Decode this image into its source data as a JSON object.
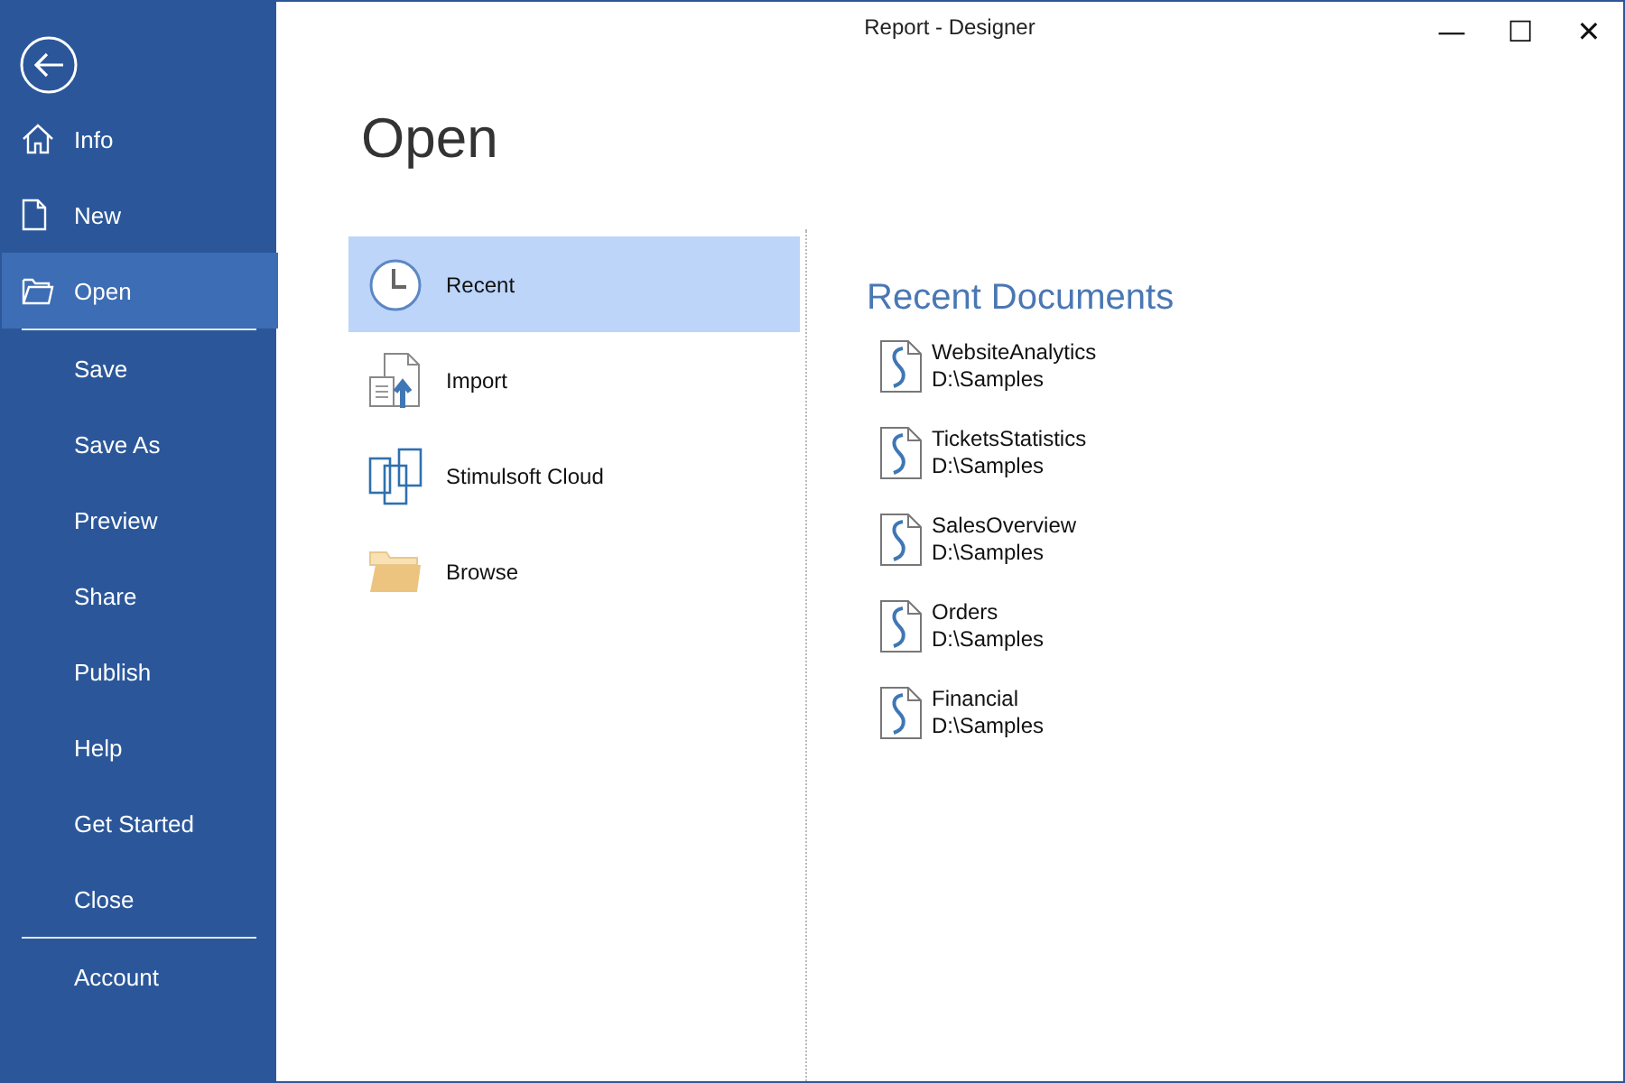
{
  "window": {
    "title": "Report - Designer",
    "controls": [
      "—",
      "☐",
      "✕"
    ]
  },
  "sidebar": {
    "items": [
      {
        "label": "Info",
        "selected": false,
        "separator_after": false
      },
      {
        "label": "New",
        "selected": false,
        "separator_after": false
      },
      {
        "label": "Open",
        "selected": true,
        "separator_after": true
      },
      {
        "label": "Save",
        "selected": false,
        "separator_after": false
      },
      {
        "label": "Save As",
        "selected": false,
        "separator_after": false
      },
      {
        "label": "Preview",
        "selected": false,
        "separator_after": false
      },
      {
        "label": "Share",
        "selected": false,
        "separator_after": false
      },
      {
        "label": "Publish",
        "selected": false,
        "separator_after": false
      },
      {
        "label": "Help",
        "selected": false,
        "separator_after": false
      },
      {
        "label": "Get Started",
        "selected": false,
        "separator_after": false
      },
      {
        "label": "Close",
        "selected": false,
        "separator_after": true
      },
      {
        "label": "Account",
        "selected": false,
        "separator_after": false
      }
    ]
  },
  "heading": "Open",
  "sources": [
    {
      "label": "Recent",
      "selected": true
    },
    {
      "label": "Import",
      "selected": false
    },
    {
      "label": "Stimulsoft Cloud",
      "selected": false
    },
    {
      "label": "Browse",
      "selected": false
    }
  ],
  "recent": {
    "title": "Recent Documents",
    "documents": [
      {
        "name": "WebsiteAnalytics",
        "path": "D:\\Samples"
      },
      {
        "name": "TicketsStatistics",
        "path": "D:\\Samples"
      },
      {
        "name": "SalesOverview",
        "path": "D:\\Samples"
      },
      {
        "name": "Orders",
        "path": "D:\\Samples"
      },
      {
        "name": "Financial",
        "path": "D:\\Samples"
      }
    ]
  }
}
